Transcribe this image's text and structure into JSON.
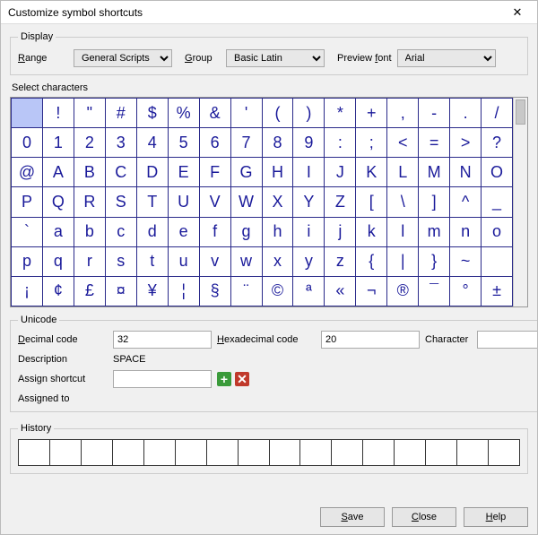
{
  "window": {
    "title": "Customize symbol shortcuts"
  },
  "display": {
    "legend": "Display",
    "range_label": "Range",
    "range_value": "General Scripts",
    "group_label": "Group",
    "group_value": "Basic Latin",
    "font_label": "Preview font",
    "font_value": "Arial"
  },
  "select_characters_label": "Select characters",
  "chars": [
    [
      " ",
      "!",
      "\"",
      "#",
      "$",
      "%",
      "&",
      "'",
      "(",
      ")",
      "*",
      "+",
      ",",
      "-",
      ".",
      "/"
    ],
    [
      "0",
      "1",
      "2",
      "3",
      "4",
      "5",
      "6",
      "7",
      "8",
      "9",
      ":",
      ";",
      "<",
      "=",
      ">",
      "?"
    ],
    [
      "@",
      "A",
      "B",
      "C",
      "D",
      "E",
      "F",
      "G",
      "H",
      "I",
      "J",
      "K",
      "L",
      "M",
      "N",
      "O"
    ],
    [
      "P",
      "Q",
      "R",
      "S",
      "T",
      "U",
      "V",
      "W",
      "X",
      "Y",
      "Z",
      "[",
      "\\",
      "]",
      "^",
      "_"
    ],
    [
      "`",
      "a",
      "b",
      "c",
      "d",
      "e",
      "f",
      "g",
      "h",
      "i",
      "j",
      "k",
      "l",
      "m",
      "n",
      "o"
    ],
    [
      "p",
      "q",
      "r",
      "s",
      "t",
      "u",
      "v",
      "w",
      "x",
      "y",
      "z",
      "{",
      "|",
      "}",
      "~",
      ""
    ],
    [
      "¡",
      "¢",
      "£",
      "¤",
      "¥",
      "¦",
      "§",
      "¨",
      "©",
      "ª",
      "«",
      "¬",
      "®",
      "¯",
      "°",
      "±"
    ]
  ],
  "selected_index": [
    0,
    0
  ],
  "unicode": {
    "legend": "Unicode",
    "decimal_label": "Decimal code",
    "decimal_value": "32",
    "hex_label": "Hexadecimal code",
    "hex_value": "20",
    "char_label": "Character",
    "char_value": "",
    "desc_label": "Description",
    "desc_value": "SPACE",
    "assign_label": "Assign shortcut",
    "assign_value": "",
    "assigned_to_label": "Assigned to"
  },
  "history": {
    "legend": "History",
    "cells": [
      "",
      "",
      "",
      "",
      "",
      "",
      "",
      "",
      "",
      "",
      "",
      "",
      "",
      "",
      "",
      ""
    ]
  },
  "buttons": {
    "save": "Save",
    "close": "Close",
    "help": "Help"
  }
}
